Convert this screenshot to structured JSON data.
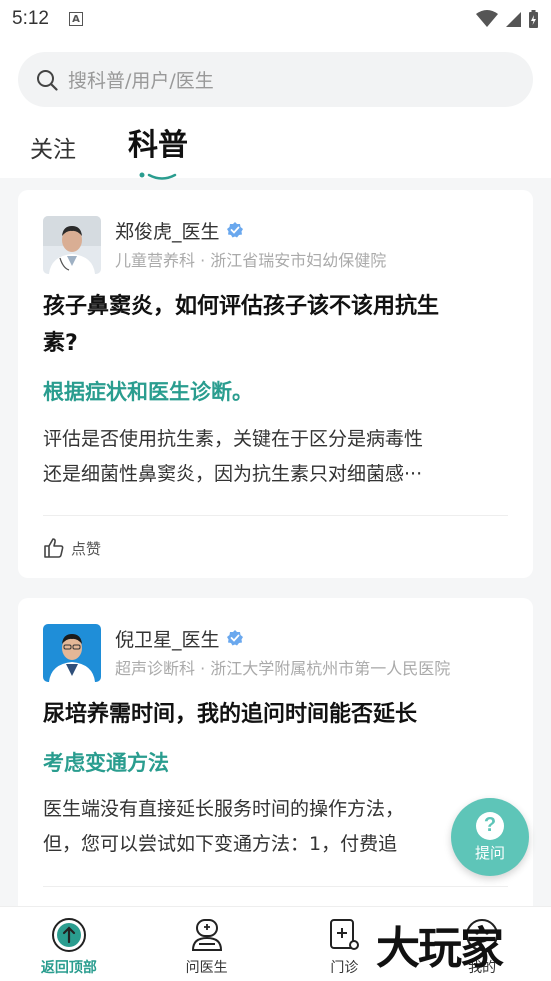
{
  "status_bar": {
    "time": "5:12",
    "notification_icon": "A"
  },
  "search": {
    "placeholder": "搜科普/用户/医生"
  },
  "tabs": [
    {
      "label": "关注",
      "active": false
    },
    {
      "label": "科普",
      "active": true
    }
  ],
  "posts": [
    {
      "author": "郑俊虎_医生",
      "verified": true,
      "department": "儿童营养科 · 浙江省瑞安市妇幼保健院",
      "question_line1": "孩子鼻窦炎，如何评估孩子该不该用抗生",
      "question_line2": "素?",
      "answer_title": "根据症状和医生诊断。",
      "answer_line1": "评估是否使用抗生素，关键在于区分是病毒性",
      "answer_line2": "还是细菌性鼻窦炎，因为抗生素只对细菌感···",
      "like_label": "点赞"
    },
    {
      "author": "倪卫星_医生",
      "verified": true,
      "department": "超声诊断科 · 浙江大学附属杭州市第一人民医院",
      "question_line1": "尿培养需时间，我的追问时间能否延长",
      "answer_title": "考虑变通方法",
      "answer_line1": "医生端没有直接延长服务时间的操作方法，",
      "answer_line2": "但，您可以尝试如下变通方法：1，付费追"
    }
  ],
  "fab": {
    "icon": "?",
    "label": "提问"
  },
  "bottom_nav": [
    {
      "label": "返回顶部",
      "icon": "arrow-up-circle-icon",
      "active": true
    },
    {
      "label": "问医生",
      "icon": "doctor-icon",
      "active": false
    },
    {
      "label": "门诊",
      "icon": "clinic-icon",
      "active": false
    },
    {
      "label": "我的",
      "icon": "profile-icon",
      "active": false
    }
  ],
  "watermark": "大玩家",
  "colors": {
    "accent": "#2a9d8f",
    "fab": "#5ec5b8",
    "verified": "#6aa8ee"
  }
}
